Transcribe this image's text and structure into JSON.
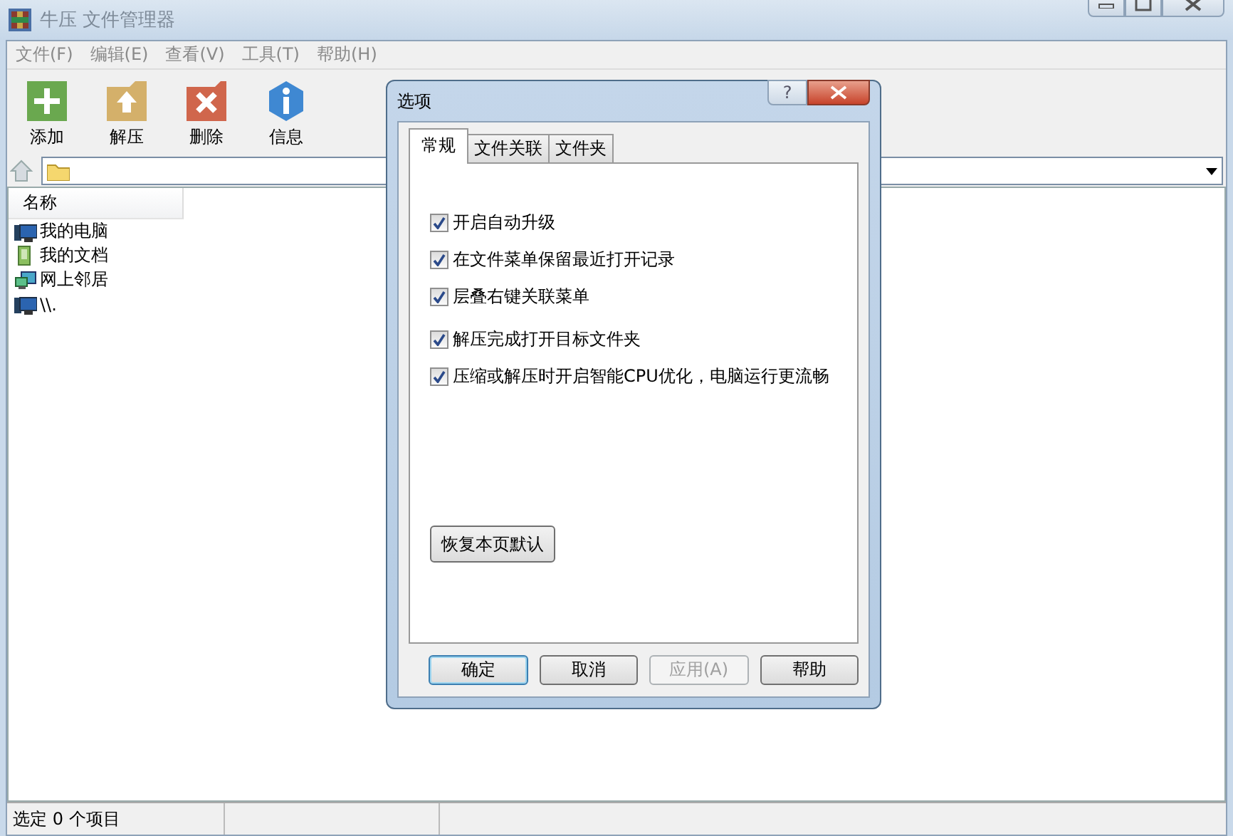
{
  "window": {
    "title": "牛压  文件管理器"
  },
  "menu": [
    "文件(F)",
    "编辑(E)",
    "查看(V)",
    "工具(T)",
    "帮助(H)"
  ],
  "toolbar": [
    {
      "kind": "add",
      "label": "添加"
    },
    {
      "kind": "extract",
      "label": "解压"
    },
    {
      "kind": "delete",
      "label": "删除"
    },
    {
      "kind": "info",
      "label": "信息"
    }
  ],
  "file_list": {
    "columns": [
      "名称"
    ],
    "rows": [
      {
        "kind": "computer",
        "name": "我的电脑"
      },
      {
        "kind": "documents",
        "name": "我的文档"
      },
      {
        "kind": "network",
        "name": "网上邻居"
      },
      {
        "kind": "computer",
        "name": "\\\\."
      }
    ]
  },
  "status_bar": [
    "选定 0 个项目"
  ],
  "dialog": {
    "title": "选项",
    "help_button": "?",
    "tabs": [
      {
        "label": "常规",
        "selected": true
      },
      {
        "label": "文件关联",
        "selected": false
      },
      {
        "label": "文件夹",
        "selected": false
      }
    ],
    "options": [
      {
        "label": "开启自动升级",
        "checked": true
      },
      {
        "label": "在文件菜单保留最近打开记录",
        "checked": true
      },
      {
        "label": "层叠右键关联菜单",
        "checked": true
      },
      {
        "label": "解压完成打开目标文件夹",
        "checked": true
      },
      {
        "label": "压缩或解压时开启智能CPU优化，电脑运行更流畅",
        "checked": true
      }
    ],
    "restore_button": "恢复本页默认",
    "buttons": [
      {
        "label": "确定",
        "default": true,
        "disabled": false
      },
      {
        "label": "取消",
        "default": false,
        "disabled": false
      },
      {
        "label": "应用(A)",
        "default": false,
        "disabled": true
      },
      {
        "label": "帮助",
        "default": false,
        "disabled": false
      }
    ]
  }
}
